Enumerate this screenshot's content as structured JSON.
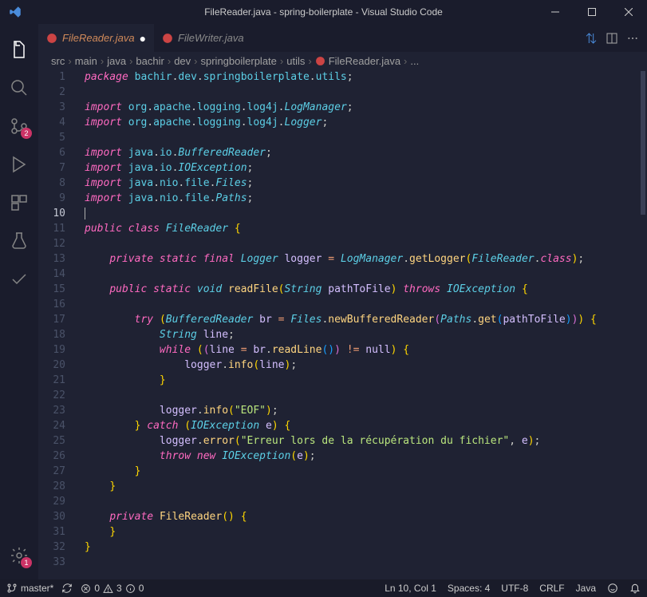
{
  "window": {
    "title": "FileReader.java - spring-boilerplate - Visual Studio Code"
  },
  "activitybar": {
    "source_control_badge": "2",
    "settings_badge": "1"
  },
  "tabs": {
    "active": {
      "label": "FileReader.java"
    },
    "inactive": {
      "label": "FileWriter.java"
    }
  },
  "breadcrumbs": {
    "parts": [
      "src",
      "main",
      "java",
      "bachir",
      "dev",
      "springboilerplate",
      "utils"
    ],
    "file": "FileReader.java",
    "tail": "..."
  },
  "code": {
    "lines": [
      {
        "n": 1,
        "t": [
          [
            "kw",
            "package "
          ],
          [
            "pkg",
            "bachir"
          ],
          [
            "punc",
            "."
          ],
          [
            "pkg",
            "dev"
          ],
          [
            "punc",
            "."
          ],
          [
            "pkg",
            "springboilerplate"
          ],
          [
            "punc",
            "."
          ],
          [
            "pkg",
            "utils"
          ],
          [
            "punc",
            ";"
          ]
        ]
      },
      {
        "n": 2,
        "t": []
      },
      {
        "n": 3,
        "t": [
          [
            "kw",
            "import "
          ],
          [
            "pkg",
            "org"
          ],
          [
            "punc",
            "."
          ],
          [
            "pkg",
            "apache"
          ],
          [
            "punc",
            "."
          ],
          [
            "pkg",
            "logging"
          ],
          [
            "punc",
            "."
          ],
          [
            "pkg",
            "log4j"
          ],
          [
            "punc",
            "."
          ],
          [
            "type",
            "LogManager"
          ],
          [
            "punc",
            ";"
          ]
        ]
      },
      {
        "n": 4,
        "t": [
          [
            "kw",
            "import "
          ],
          [
            "pkg",
            "org"
          ],
          [
            "punc",
            "."
          ],
          [
            "pkg",
            "apache"
          ],
          [
            "punc",
            "."
          ],
          [
            "pkg",
            "logging"
          ],
          [
            "punc",
            "."
          ],
          [
            "pkg",
            "log4j"
          ],
          [
            "punc",
            "."
          ],
          [
            "type",
            "Logger"
          ],
          [
            "punc",
            ";"
          ]
        ]
      },
      {
        "n": 5,
        "t": []
      },
      {
        "n": 6,
        "t": [
          [
            "kw",
            "import "
          ],
          [
            "pkg",
            "java"
          ],
          [
            "punc",
            "."
          ],
          [
            "pkg",
            "io"
          ],
          [
            "punc",
            "."
          ],
          [
            "type",
            "BufferedReader"
          ],
          [
            "punc",
            ";"
          ]
        ]
      },
      {
        "n": 7,
        "t": [
          [
            "kw",
            "import "
          ],
          [
            "pkg",
            "java"
          ],
          [
            "punc",
            "."
          ],
          [
            "pkg",
            "io"
          ],
          [
            "punc",
            "."
          ],
          [
            "type",
            "IOException"
          ],
          [
            "punc",
            ";"
          ]
        ]
      },
      {
        "n": 8,
        "t": [
          [
            "kw",
            "import "
          ],
          [
            "pkg",
            "java"
          ],
          [
            "punc",
            "."
          ],
          [
            "pkg",
            "nio"
          ],
          [
            "punc",
            "."
          ],
          [
            "pkg",
            "file"
          ],
          [
            "punc",
            "."
          ],
          [
            "type",
            "Files"
          ],
          [
            "punc",
            ";"
          ]
        ]
      },
      {
        "n": 9,
        "t": [
          [
            "kw",
            "import "
          ],
          [
            "pkg",
            "java"
          ],
          [
            "punc",
            "."
          ],
          [
            "pkg",
            "nio"
          ],
          [
            "punc",
            "."
          ],
          [
            "pkg",
            "file"
          ],
          [
            "punc",
            "."
          ],
          [
            "type",
            "Paths"
          ],
          [
            "punc",
            ";"
          ]
        ]
      },
      {
        "n": 10,
        "current": true,
        "t": [
          [
            "cursor",
            ""
          ]
        ]
      },
      {
        "n": 11,
        "t": [
          [
            "kw",
            "public class "
          ],
          [
            "type",
            "FileReader"
          ],
          [
            "punc",
            " "
          ],
          [
            "paren1",
            "{"
          ]
        ]
      },
      {
        "n": 12,
        "t": []
      },
      {
        "n": 13,
        "t": [
          [
            "",
            "    "
          ],
          [
            "kw",
            "private static final "
          ],
          [
            "type",
            "Logger"
          ],
          [
            "punc",
            " "
          ],
          [
            "var",
            "logger"
          ],
          [
            "punc",
            " "
          ],
          [
            "op",
            "="
          ],
          [
            "punc",
            " "
          ],
          [
            "type",
            "LogManager"
          ],
          [
            "punc",
            "."
          ],
          [
            "fn",
            "getLogger"
          ],
          [
            "paren1",
            "("
          ],
          [
            "type",
            "FileReader"
          ],
          [
            "punc",
            "."
          ],
          [
            "kw",
            "class"
          ],
          [
            "paren1",
            ")"
          ],
          [
            "punc",
            ";"
          ]
        ]
      },
      {
        "n": 14,
        "t": []
      },
      {
        "n": 15,
        "t": [
          [
            "",
            "    "
          ],
          [
            "kw",
            "public static "
          ],
          [
            "type",
            "void"
          ],
          [
            "punc",
            " "
          ],
          [
            "fn",
            "readFile"
          ],
          [
            "paren1",
            "("
          ],
          [
            "type",
            "String"
          ],
          [
            "punc",
            " "
          ],
          [
            "var",
            "pathToFile"
          ],
          [
            "paren1",
            ")"
          ],
          [
            "punc",
            " "
          ],
          [
            "kw",
            "throws"
          ],
          [
            "punc",
            " "
          ],
          [
            "type",
            "IOException"
          ],
          [
            "punc",
            " "
          ],
          [
            "paren1",
            "{"
          ]
        ]
      },
      {
        "n": 16,
        "t": []
      },
      {
        "n": 17,
        "fold": true,
        "t": [
          [
            "",
            "        "
          ],
          [
            "kw",
            "try"
          ],
          [
            "punc",
            " "
          ],
          [
            "paren1",
            "("
          ],
          [
            "type",
            "BufferedReader"
          ],
          [
            "punc",
            " "
          ],
          [
            "var",
            "br"
          ],
          [
            "punc",
            " "
          ],
          [
            "op",
            "="
          ],
          [
            "punc",
            " "
          ],
          [
            "type",
            "Files"
          ],
          [
            "punc",
            "."
          ],
          [
            "fn",
            "newBufferedReader"
          ],
          [
            "paren2",
            "("
          ],
          [
            "type",
            "Paths"
          ],
          [
            "punc",
            "."
          ],
          [
            "fn",
            "get"
          ],
          [
            "paren3",
            "("
          ],
          [
            "var",
            "pathToFile"
          ],
          [
            "paren3",
            ")"
          ],
          [
            "paren2",
            ")"
          ],
          [
            "paren1",
            ")"
          ],
          [
            "punc",
            " "
          ],
          [
            "paren1",
            "{"
          ]
        ]
      },
      {
        "n": 18,
        "t": [
          [
            "",
            "            "
          ],
          [
            "type",
            "String"
          ],
          [
            "punc",
            " "
          ],
          [
            "var",
            "line"
          ],
          [
            "punc",
            ";"
          ]
        ]
      },
      {
        "n": 19,
        "t": [
          [
            "",
            "            "
          ],
          [
            "kw",
            "while"
          ],
          [
            "punc",
            " "
          ],
          [
            "paren1",
            "("
          ],
          [
            "paren2",
            "("
          ],
          [
            "var",
            "line"
          ],
          [
            "punc",
            " "
          ],
          [
            "op",
            "="
          ],
          [
            "punc",
            " "
          ],
          [
            "var",
            "br"
          ],
          [
            "punc",
            "."
          ],
          [
            "fn",
            "readLine"
          ],
          [
            "paren3",
            "("
          ],
          [
            "paren3",
            ")"
          ],
          [
            "paren2",
            ")"
          ],
          [
            "punc",
            " "
          ],
          [
            "op",
            "!="
          ],
          [
            "punc",
            " "
          ],
          [
            "var",
            "null"
          ],
          [
            "paren1",
            ")"
          ],
          [
            "punc",
            " "
          ],
          [
            "paren1",
            "{"
          ]
        ]
      },
      {
        "n": 20,
        "t": [
          [
            "",
            "                "
          ],
          [
            "var",
            "logger"
          ],
          [
            "punc",
            "."
          ],
          [
            "fn",
            "info"
          ],
          [
            "paren1",
            "("
          ],
          [
            "var",
            "line"
          ],
          [
            "paren1",
            ")"
          ],
          [
            "punc",
            ";"
          ]
        ]
      },
      {
        "n": 21,
        "t": [
          [
            "",
            "            "
          ],
          [
            "paren1",
            "}"
          ]
        ]
      },
      {
        "n": 22,
        "t": []
      },
      {
        "n": 23,
        "t": [
          [
            "",
            "            "
          ],
          [
            "var",
            "logger"
          ],
          [
            "punc",
            "."
          ],
          [
            "fn",
            "info"
          ],
          [
            "paren1",
            "("
          ],
          [
            "str",
            "\"EOF\""
          ],
          [
            "paren1",
            ")"
          ],
          [
            "punc",
            ";"
          ]
        ]
      },
      {
        "n": 24,
        "t": [
          [
            "",
            "        "
          ],
          [
            "paren1",
            "}"
          ],
          [
            "punc",
            " "
          ],
          [
            "kw",
            "catch"
          ],
          [
            "punc",
            " "
          ],
          [
            "paren1",
            "("
          ],
          [
            "type",
            "IOException"
          ],
          [
            "punc",
            " "
          ],
          [
            "var",
            "e"
          ],
          [
            "paren1",
            ")"
          ],
          [
            "punc",
            " "
          ],
          [
            "paren1",
            "{"
          ]
        ]
      },
      {
        "n": 25,
        "t": [
          [
            "",
            "            "
          ],
          [
            "var",
            "logger"
          ],
          [
            "punc",
            "."
          ],
          [
            "fn",
            "error"
          ],
          [
            "paren1",
            "("
          ],
          [
            "str",
            "\"Erreur lors de la récupération du fichier\""
          ],
          [
            "punc",
            ", "
          ],
          [
            "var",
            "e"
          ],
          [
            "paren1",
            ")"
          ],
          [
            "punc",
            ";"
          ]
        ]
      },
      {
        "n": 26,
        "t": [
          [
            "",
            "            "
          ],
          [
            "kw",
            "throw new "
          ],
          [
            "type",
            "IOException"
          ],
          [
            "paren1",
            "("
          ],
          [
            "var",
            "e"
          ],
          [
            "paren1",
            ")"
          ],
          [
            "punc",
            ";"
          ]
        ]
      },
      {
        "n": 27,
        "t": [
          [
            "",
            "        "
          ],
          [
            "paren1",
            "}"
          ]
        ]
      },
      {
        "n": 28,
        "t": [
          [
            "",
            "    "
          ],
          [
            "paren1",
            "}"
          ]
        ]
      },
      {
        "n": 29,
        "t": []
      },
      {
        "n": 30,
        "t": [
          [
            "",
            "    "
          ],
          [
            "kw",
            "private "
          ],
          [
            "fn",
            "FileReader"
          ],
          [
            "paren1",
            "("
          ],
          [
            "paren1",
            ")"
          ],
          [
            "punc",
            " "
          ],
          [
            "paren1",
            "{"
          ]
        ]
      },
      {
        "n": 31,
        "t": [
          [
            "",
            "    "
          ],
          [
            "paren1",
            "}"
          ]
        ]
      },
      {
        "n": 32,
        "t": [
          [
            "paren1",
            "}"
          ]
        ]
      },
      {
        "n": 33,
        "t": []
      }
    ]
  },
  "statusbar": {
    "branch": "master*",
    "sync": "",
    "errors": "0",
    "warnings": "3",
    "info": "0",
    "position": "Ln 10, Col 1",
    "spaces": "Spaces: 4",
    "encoding": "UTF-8",
    "eol": "CRLF",
    "language": "Java",
    "feedback": "",
    "bell": ""
  }
}
